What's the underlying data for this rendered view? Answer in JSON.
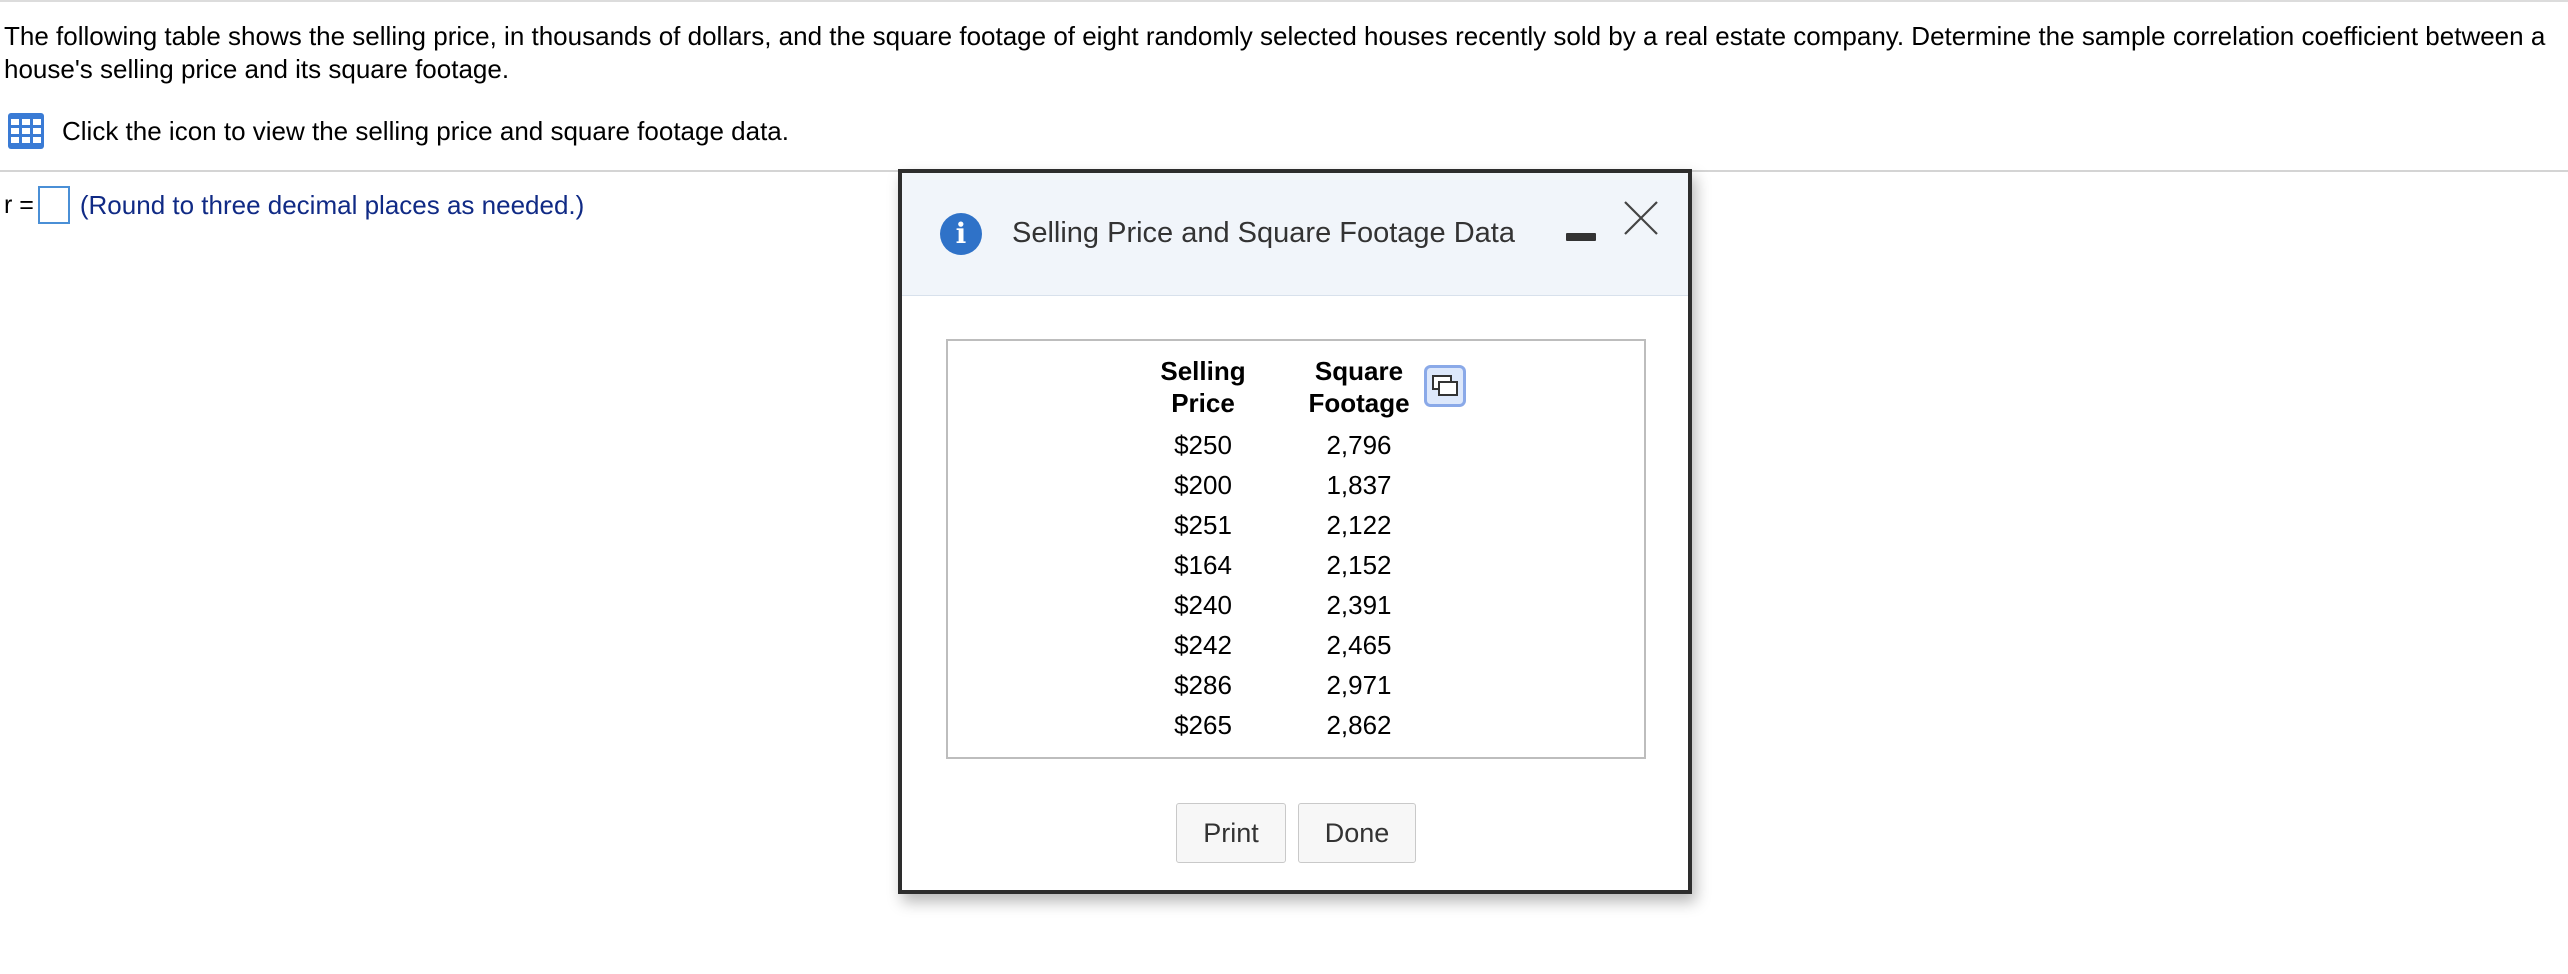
{
  "question": {
    "text": "The following table shows the selling price, in thousands of dollars, and the square footage of eight randomly selected houses recently sold by a real estate company. Determine the sample correlation coefficient between a house's selling price and its square footage."
  },
  "data_link": {
    "icon": "table-grid-icon",
    "text": "Click the icon to view the selling price and square footage data."
  },
  "answer": {
    "label": "r =",
    "value": "",
    "note": "(Round to three decimal places as needed.)"
  },
  "dialog": {
    "title": "Selling Price and Square Footage Data",
    "info_icon": "info-icon",
    "table": {
      "headers": {
        "price_line1": "Selling",
        "price_line2": "Price",
        "sqft_line1": "Square",
        "sqft_line2": "Footage"
      },
      "rows": [
        {
          "price": "$250",
          "sqft": "2,796"
        },
        {
          "price": "$200",
          "sqft": "1,837"
        },
        {
          "price": "$251",
          "sqft": "2,122"
        },
        {
          "price": "$164",
          "sqft": "2,152"
        },
        {
          "price": "$240",
          "sqft": "2,391"
        },
        {
          "price": "$242",
          "sqft": "2,465"
        },
        {
          "price": "$286",
          "sqft": "2,971"
        },
        {
          "price": "$265",
          "sqft": "2,862"
        }
      ]
    },
    "buttons": {
      "print": "Print",
      "done": "Done"
    }
  },
  "colors": {
    "accent_blue": "#2f72c8",
    "note_text": "#102a85",
    "header_bg": "#f1f5fa"
  }
}
